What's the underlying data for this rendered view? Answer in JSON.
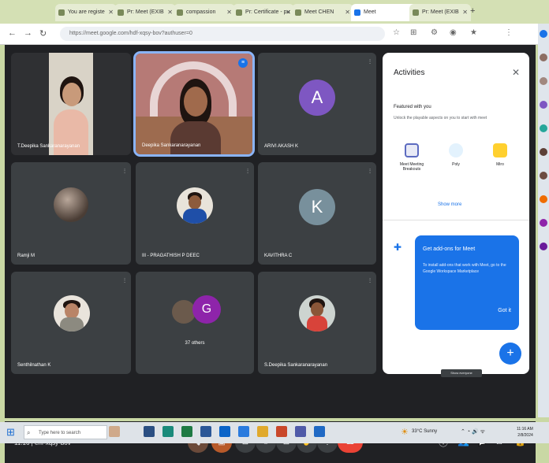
{
  "browser": {
    "tabs": [
      {
        "label": "You are registe"
      },
      {
        "label": "Pr: Meet (EXIB"
      },
      {
        "label": "compassion"
      },
      {
        "label": "Pr: Certificate - pu"
      },
      {
        "label": "Meet CHEN"
      },
      {
        "label": "Pr: Meet (EXIB"
      },
      {
        "label": "Meet",
        "active": true
      },
      {
        "label": "Pr: Meet (EXIB"
      }
    ],
    "url": "https://meet.google.com/hdf-xqsy-bov?authuser=0"
  },
  "meet": {
    "participants": [
      {
        "name": "T.Deepika Sankaranarayanan"
      },
      {
        "name": "Deepika Sankaranarayanan"
      },
      {
        "name": "ARIVI AKASH K",
        "initial": "A",
        "avatar_color": "#7e57c2"
      },
      {
        "name": "Ramji M"
      },
      {
        "name": "III - PRAGATHISH P DEEC"
      },
      {
        "name": "KAVITHRA C",
        "initial": "K",
        "avatar_color": "#78909c"
      },
      {
        "name": "Senthilnathan K"
      },
      {
        "name": "37 others",
        "initial": "G",
        "avatar_color": "#8e24aa"
      },
      {
        "name": "S.Deepika Sankaranarayanan"
      }
    ],
    "meeting_info": "11:16 | ehf-xqsy-bov",
    "tooltip": "Show everyone"
  },
  "activities": {
    "title": "Activities",
    "feature_title": "Featured with you",
    "feature_sub": "Unlock the playable aspects on you to start with meet",
    "items": [
      {
        "label": "Meet Meeting Breakouts"
      },
      {
        "label": "Poly"
      },
      {
        "label": "Miro"
      }
    ],
    "show_more": "Show more",
    "addon_title": "Get add-ons for Meet",
    "addon_body": "To install add-ons that work with Meet, go to the Google Workspace Marketplace",
    "got_it": "Got it"
  },
  "taskbar": {
    "search_placeholder": "Type here to search",
    "weather": "33°C Sunny",
    "time": "11:16 AM",
    "date": "2/8/2024"
  }
}
